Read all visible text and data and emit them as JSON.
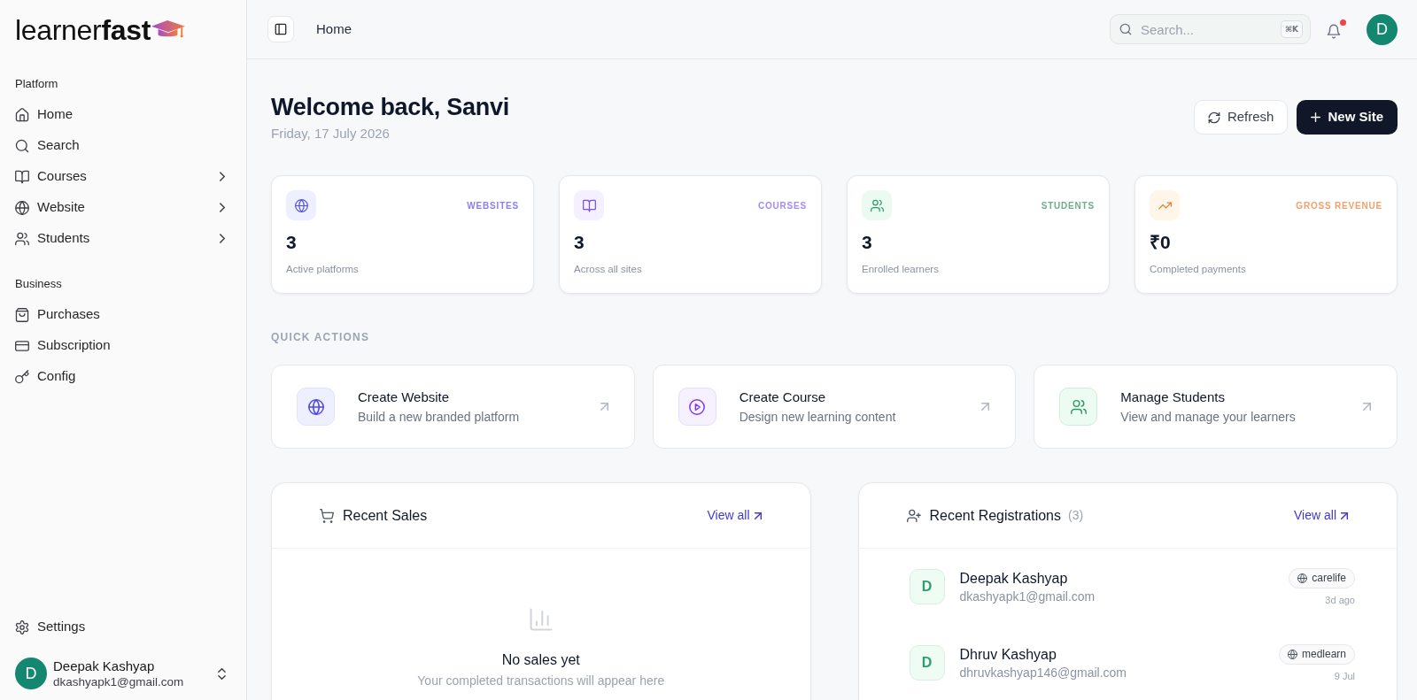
{
  "sidebar": {
    "logo": "learner**fast**",
    "sections": [
      {
        "label": "Platform",
        "items": [
          {
            "label": "Home",
            "kind": "link"
          },
          {
            "label": "Search",
            "kind": "link"
          },
          {
            "label": "Courses",
            "kind": "group",
            "expanded": false
          },
          {
            "label": "Website",
            "kind": "group",
            "expanded": false
          },
          {
            "label": "Students",
            "kind": "group",
            "expanded": false
          }
        ]
      },
      {
        "label": "Business",
        "items": [
          {
            "label": "Purchases",
            "kind": "link"
          },
          {
            "label": "Subscription",
            "kind": "link"
          },
          {
            "label": "Config",
            "kind": "link"
          }
        ]
      }
    ],
    "footer_items": [
      {
        "label": "Settings"
      }
    ],
    "user": {
      "initial": "D",
      "name": "Deepak Kashyap",
      "email": "dkashyapk1@gmail.com"
    }
  },
  "topbar": {
    "breadcrumb": "Home",
    "search": {
      "placeholder": "Search...",
      "shortcut": "⌘K"
    },
    "notifications": {
      "unread": true
    },
    "avatar": {
      "initial": "D"
    }
  },
  "header": {
    "title": "Welcome back, Sanvi",
    "date": "Friday, 17 July 2026",
    "buttons": [
      {
        "label": "Refresh",
        "kind": "secondary"
      },
      {
        "label": "New Site",
        "kind": "primary"
      }
    ]
  },
  "stats": [
    {
      "label": "WEBSITES",
      "value": "3",
      "caption": "Active platforms",
      "color": "#8b7ff5"
    },
    {
      "label": "COURSES",
      "value": "3",
      "caption": "Across all sites",
      "color": "#a58bf6"
    },
    {
      "label": "STUDENTS",
      "value": "3",
      "caption": "Enrolled learners",
      "color": "#6fae8c"
    },
    {
      "label": "GROSS REVENUE",
      "value": "₹0",
      "caption": "Completed payments",
      "color": "#f1a26c"
    }
  ],
  "quick_actions": {
    "title": "QUICK ACTIONS",
    "items": [
      {
        "title": "Create Website",
        "description": "Build a new branded platform"
      },
      {
        "title": "Create Course",
        "description": "Design new learning content"
      },
      {
        "title": "Manage Students",
        "description": "View and manage your learners"
      }
    ]
  },
  "recent_sales": {
    "title": "Recent Sales",
    "link": "View all",
    "empty": {
      "title": "No sales yet",
      "message": "Your completed transactions will appear here"
    }
  },
  "recent_registrations": {
    "title": "Recent Registrations",
    "count": "(3)",
    "link": "View all",
    "items": [
      {
        "initial": "D",
        "name": "Deepak Kashyap",
        "email": "dkashyapk1@gmail.com",
        "site": "carelife",
        "time": "3d ago"
      },
      {
        "initial": "D",
        "name": "Dhruv Kashyap",
        "email": "dhruvkashyap146@gmail.com",
        "site": "medlearn",
        "time": "9 Jul"
      }
    ]
  }
}
